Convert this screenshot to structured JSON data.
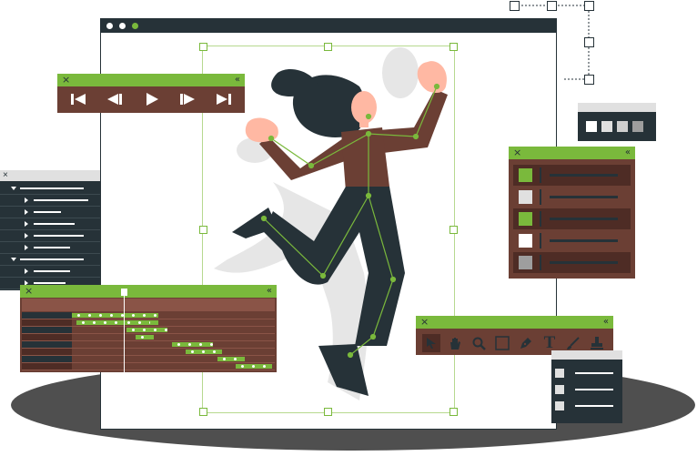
{
  "colors": {
    "green": "#7ab93c",
    "brown": "#6b3f34",
    "dark": "#263238",
    "light_brown": "#8a5447",
    "floor": "#4a4a4a",
    "skin": "#ffb8a3"
  },
  "player_controls": {
    "close_icon": "×",
    "collapse_icon": "«",
    "buttons": [
      "skip-back-icon",
      "step-back-icon",
      "play-icon",
      "step-forward-icon",
      "skip-forward-icon"
    ]
  },
  "layers_panel": {
    "close_icon": "×",
    "rows": 9
  },
  "timeline_panel": {
    "close_icon": "×",
    "collapse_icon": "«"
  },
  "swatch_panel": {
    "close_icon": "×",
    "collapse_icon": "«",
    "swatches": [
      "#7ab93c",
      "#e0e0e0",
      "#7ab93c",
      "#ffffff",
      "#9e9e9e"
    ]
  },
  "tools_panel": {
    "close_icon": "×",
    "collapse_icon": "«",
    "tools": [
      "pointer-icon",
      "hand-icon",
      "zoom-icon",
      "rectangle-icon",
      "pen-icon",
      "text-icon",
      "brush-icon",
      "stamp-icon"
    ],
    "text_tool_glyph": "T"
  },
  "mini_swatch_panel": {
    "swatches": [
      "#ffffff",
      "#e0e0e0",
      "#cfcfcf",
      "#9e9e9e"
    ]
  }
}
